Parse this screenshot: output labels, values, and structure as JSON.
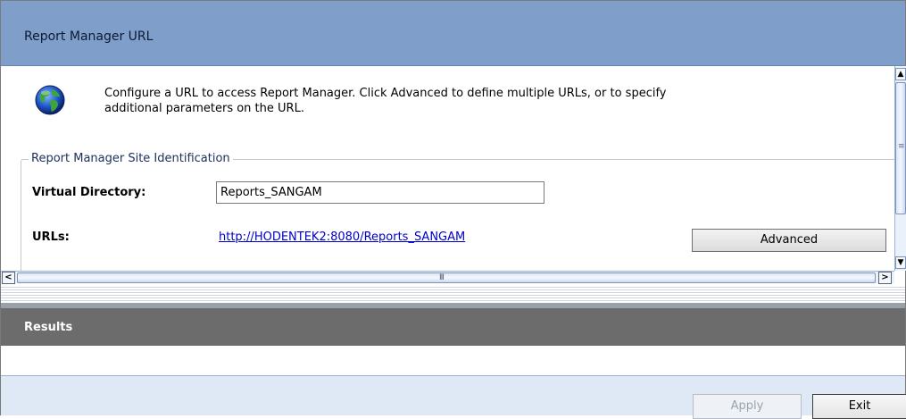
{
  "header": {
    "title": "Report Manager URL"
  },
  "intro": {
    "icon": "globe-icon",
    "line1": "Configure a URL to access Report Manager.  Click Advanced to define multiple URLs, or to specify",
    "line2": "additional parameters on the URL."
  },
  "site_identification": {
    "legend": "Report Manager Site Identification",
    "virtual_directory_label": "Virtual Directory:",
    "virtual_directory_value": "Reports_SANGAM",
    "urls_label": "URLs:",
    "url_link": "http://HODENTEK2:8080/Reports_SANGAM",
    "advanced_button": "Advanced"
  },
  "scrollbars": {
    "vertical_up": "▲",
    "vertical_down": "▼",
    "horizontal_left": "<",
    "horizontal_right": ">",
    "grip": "III"
  },
  "results": {
    "title": "Results"
  },
  "footer": {
    "apply_button": "Apply",
    "exit_button": "Exit"
  },
  "colors": {
    "header_bg": "#7f9fca",
    "results_bg": "#6c6c6c",
    "footer_bg": "#dfe9f5",
    "link": "#0000cc"
  }
}
